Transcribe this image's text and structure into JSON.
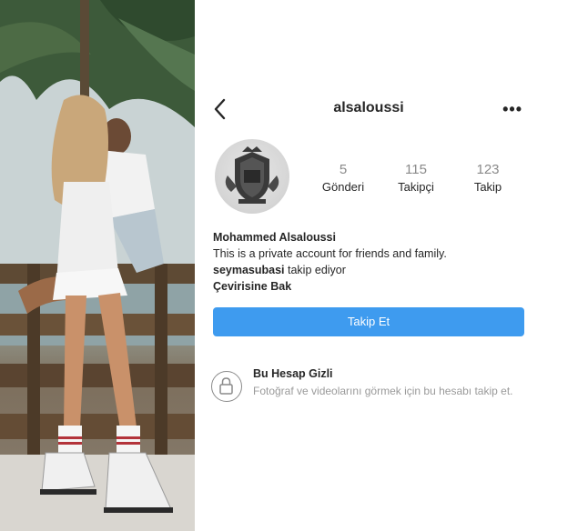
{
  "header": {
    "username": "alsaloussi",
    "back_icon": "chevron-left-icon",
    "more_label": "•••"
  },
  "profile": {
    "avatar_icon": "crest-logo",
    "stats": [
      {
        "value": "5",
        "label": "Gönderi"
      },
      {
        "value": "115",
        "label": "Takipçi"
      },
      {
        "value": "123",
        "label": "Takip"
      }
    ]
  },
  "bio": {
    "name": "Mohammed Alsaloussi",
    "text": "This is a private account for friends and family.",
    "followed_by_user": "seymasubasi",
    "followed_by_suffix": " takip ediyor",
    "translate": "Çevirisine Bak"
  },
  "actions": {
    "follow_label": "Takip Et",
    "follow_color": "#3e9bef"
  },
  "private_notice": {
    "icon": "lock-icon",
    "title": "Bu Hesap Gizli",
    "description": "Fotoğraf ve videolarını görmek için bu hesabı takip et."
  }
}
